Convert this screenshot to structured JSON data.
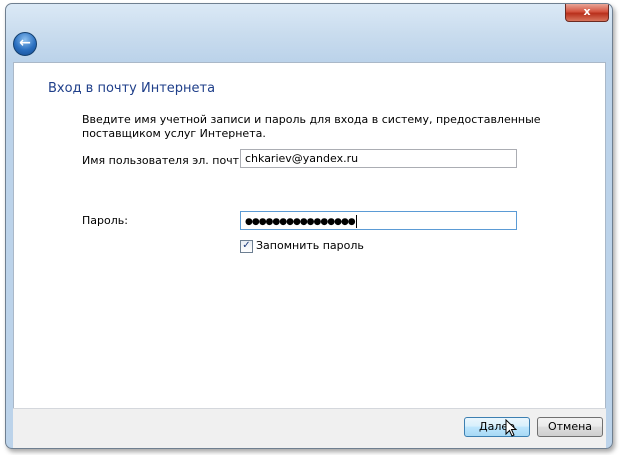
{
  "window": {
    "close_label": "x",
    "title": "Вход в почту Интернета"
  },
  "description": "Введите имя учетной записи и пароль для входа в систему, предоставленные поставщиком услуг Интернета.",
  "form": {
    "username_label": "Имя пользователя эл. почты:",
    "username_value": "chkariev@yandex.ru",
    "password_label": "Пароль:",
    "password_value": "●●●●●●●●●●●●●●●●",
    "remember_label": "Запомнить пароль",
    "remember_checked": true
  },
  "buttons": {
    "next_label": "Далее",
    "cancel_label": "Отмена"
  },
  "icons": {
    "back": "back-arrow-icon",
    "close": "close-icon",
    "cursor": "mouse-pointer-icon"
  }
}
